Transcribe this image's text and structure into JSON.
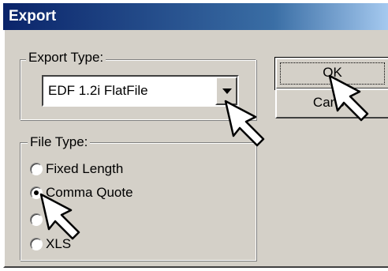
{
  "window": {
    "title": "Export"
  },
  "export_type": {
    "legend": "Export Type:",
    "selected_value": "EDF 1.2i FlatFile"
  },
  "buttons": {
    "ok_label": "OK",
    "cancel_label": "Cance"
  },
  "file_type": {
    "legend": "File Type:",
    "options": [
      {
        "label": "Fixed Length",
        "checked": false
      },
      {
        "label": "Comma Quote",
        "checked": true
      },
      {
        "label": "",
        "checked": false
      },
      {
        "label": "XLS",
        "checked": false
      }
    ]
  },
  "colors": {
    "dialog_face": "#d4d0c8",
    "title_bar_start": "#0a246a",
    "title_bar_end": "#a6caf0",
    "title_text": "#ffffff"
  },
  "icons": {
    "pointer": "arrow-cursor-icon"
  }
}
